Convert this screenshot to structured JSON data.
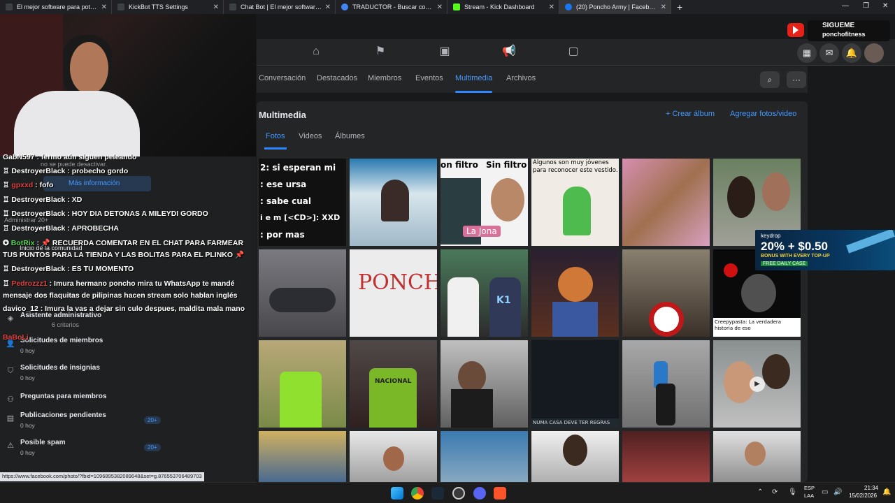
{
  "browser": {
    "tabs": [
      {
        "title": "El mejor software para potencia",
        "color": "#3c4043",
        "active": false
      },
      {
        "title": "KickBot TTS Settings",
        "color": "#3c4043",
        "active": false
      },
      {
        "title": "Chat Bot | El mejor software pa",
        "color": "#3c4043",
        "active": false
      },
      {
        "title": "TRADUCTOR - Buscar con Goo",
        "color": "#4285f4",
        "active": false
      },
      {
        "title": "Stream - Kick Dashboard",
        "color": "#53fc18",
        "active": false
      },
      {
        "title": "(20) Poncho Army | Facebook",
        "color": "#1877f2",
        "active": true
      }
    ],
    "new_tab": "+",
    "status_url": "https://www.facebook.com/photo/?fbid=1096895382089648&set=g.876553706489703"
  },
  "overlay": {
    "follow_title": "SIGUEME",
    "follow_handle": "ponchofitness",
    "promo_brand": "keydrop",
    "promo_headline": "20% + $0.50",
    "promo_sub": "BONUS WITH EVERY TOP-UP",
    "promo_tag": "FREE DAILY CASE"
  },
  "group_tabs": [
    "Conversación",
    "Destacados",
    "Miembros",
    "Eventos",
    "Multimedia",
    "Archivos"
  ],
  "active_group_tab": "Multimedia",
  "media": {
    "title": "Multimedia",
    "create_album": "+ Crear álbum",
    "add_media": "Agregar fotos/video",
    "subtabs": [
      "Fotos",
      "Videos",
      "Álbumes"
    ],
    "active_subtab": "Fotos",
    "captions": {
      "p1": "2: si esperan mi",
      "p1b": ": ese ursa",
      "p1c": ": sabe cual",
      "p1d": "i e m [<CD>]: XXD",
      "p1e": ": por mas",
      "p3a": "on filtro",
      "p3b": "Sin filtro",
      "p3c": "La Jona",
      "p4": "Algunos son muy jóvenes para reconocer este vestido.",
      "p8": "PONCHO",
      "p10": "K1",
      "p12": "Creepypasta: La verdadera historia de eso",
      "p14": "NACIONAL",
      "p16": "NUMA CASA DEVE TER REGRAS"
    }
  },
  "chat": [
    {
      "user": "GabN597",
      "text": "fermo aún siguen peleando",
      "color": "white"
    },
    {
      "user": "DestroyerBlack",
      "text": "probecho gordo",
      "color": "white"
    },
    {
      "user": "gpxxd",
      "text": "fofo",
      "color": "red"
    },
    {
      "user": "DestroyerBlack",
      "text": "XD",
      "color": "white"
    },
    {
      "user": "DestroyerBlack",
      "text": "HOY DIA DETONAS A MILEYDI GORDO",
      "color": "white"
    },
    {
      "user": "DestroyerBlack",
      "text": "APROBECHA",
      "color": "white"
    },
    {
      "user": "BotRix",
      "text": "📌 RECUERDA COMENTAR EN EL CHAT PARA FARMEAR",
      "color": "green"
    },
    {
      "user": "",
      "text": "TUS PUNTOS PARA LA TIENDA Y LAS BOLITAS PARA EL PLINKO 📌",
      "color": "white"
    },
    {
      "user": "DestroyerBlack",
      "text": "ES TU MOMENTO",
      "color": "white"
    },
    {
      "user": "Pedrozzz1",
      "text": "Imura hermano poncho mira tu WhatsApp te mandé",
      "color": "red"
    },
    {
      "user": "",
      "text": "mensaje dos flaquitas de pilipinas hacen stream solo hablan inglés",
      "color": "white"
    },
    {
      "user": "davico_12",
      "text": "Imura la vas a dejar sin culo despues, maldita mala mano",
      "color": "white"
    },
    {
      "user": "BaBoLi",
      "text": "",
      "color": "red"
    }
  ],
  "sidebar_ghost": {
    "no_desactivar": "no se puede desactivar.",
    "mas_info": "Más información",
    "administrar": "Administrar 20+",
    "inicio": "Inicio de la comunidad",
    "criterios": "6 criterios"
  },
  "sidebar_items": [
    {
      "label": "Asistente administrativo",
      "sub": "",
      "badge": ""
    },
    {
      "label": "Solicitudes de miembros",
      "sub": "0 hoy",
      "badge": ""
    },
    {
      "label": "Solicitudes de insignias",
      "sub": "0 hoy",
      "badge": ""
    },
    {
      "label": "Preguntas para miembros",
      "sub": "",
      "badge": ""
    },
    {
      "label": "Publicaciones pendientes",
      "sub": "0 hoy",
      "badge": "20+"
    },
    {
      "label": "Posible spam",
      "sub": "0 hoy",
      "badge": "20+"
    }
  ],
  "taskbar": {
    "lang": "ESP",
    "lang2": "LAA",
    "time": "21:34",
    "date": "15/02/2026"
  }
}
